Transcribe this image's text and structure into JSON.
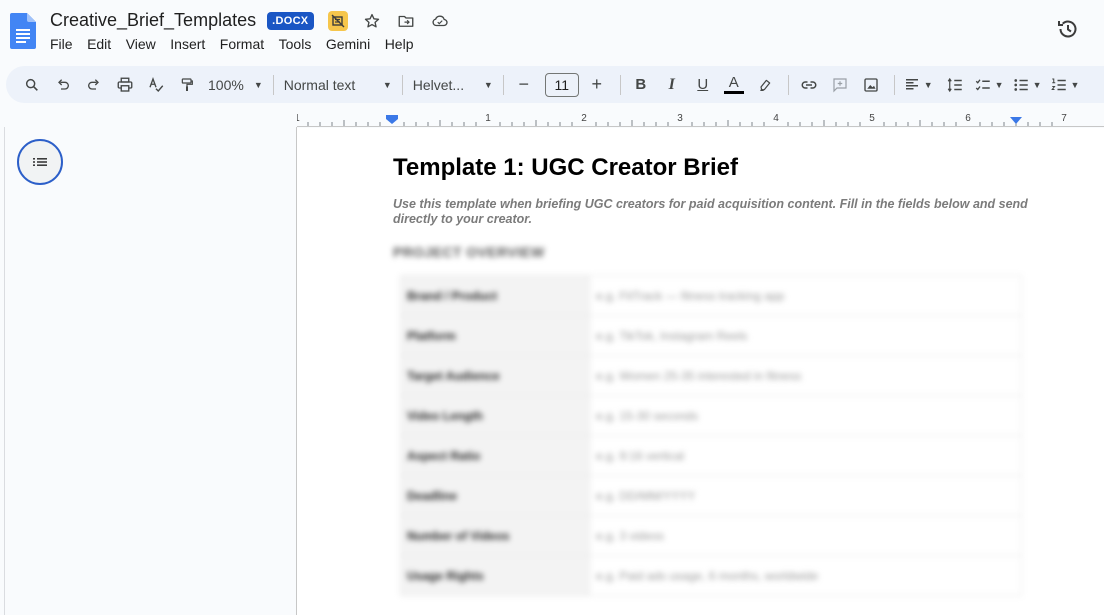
{
  "app": {
    "doc_title": "Creative_Brief_Templates",
    "file_badge": ".DOCX",
    "icons": [
      "docs-logo-icon",
      "offline-unavailable-icon",
      "star-icon",
      "move-to-folder-icon",
      "cloud-status-icon",
      "version-history-icon"
    ],
    "colors": {
      "accent": "#1a56c4",
      "offline_badge": "#f6c64c",
      "toolbar_bg": "#edf2fa"
    }
  },
  "menu": [
    "File",
    "Edit",
    "View",
    "Insert",
    "Format",
    "Tools",
    "Gemini",
    "Help"
  ],
  "toolbar": {
    "zoom": "100%",
    "style": "Normal text",
    "font": "Helvet...",
    "font_size": "11",
    "minus": "−",
    "plus": "+",
    "bold": "B",
    "italic": "I",
    "underline": "U",
    "text_color": "A"
  },
  "ruler": {
    "marks": [
      "1",
      "1",
      "2",
      "3",
      "4",
      "5",
      "6",
      "7"
    ]
  },
  "document": {
    "heading": "Template 1: UGC Creator Brief",
    "intro": "Use this template when briefing UGC creators for paid acquisition content. Fill in the fields below and send directly to your creator.",
    "section_title": "PROJECT OVERVIEW",
    "rows": [
      {
        "label": "Brand / Product",
        "value": "e.g. FitTrack — fitness tracking app"
      },
      {
        "label": "Platform",
        "value": "e.g. TikTok, Instagram Reels"
      },
      {
        "label": "Target Audience",
        "value": "e.g. Women 25-35 interested in fitness"
      },
      {
        "label": "Video Length",
        "value": "e.g. 15-30 seconds"
      },
      {
        "label": "Aspect Ratio",
        "value": "e.g. 9:16 vertical"
      },
      {
        "label": "Deadline",
        "value": "e.g. DD/MM/YYYY"
      },
      {
        "label": "Number of Videos",
        "value": "e.g. 3 videos"
      },
      {
        "label": "Usage Rights",
        "value": "e.g. Paid ads usage, 6 months, worldwide"
      }
    ]
  }
}
